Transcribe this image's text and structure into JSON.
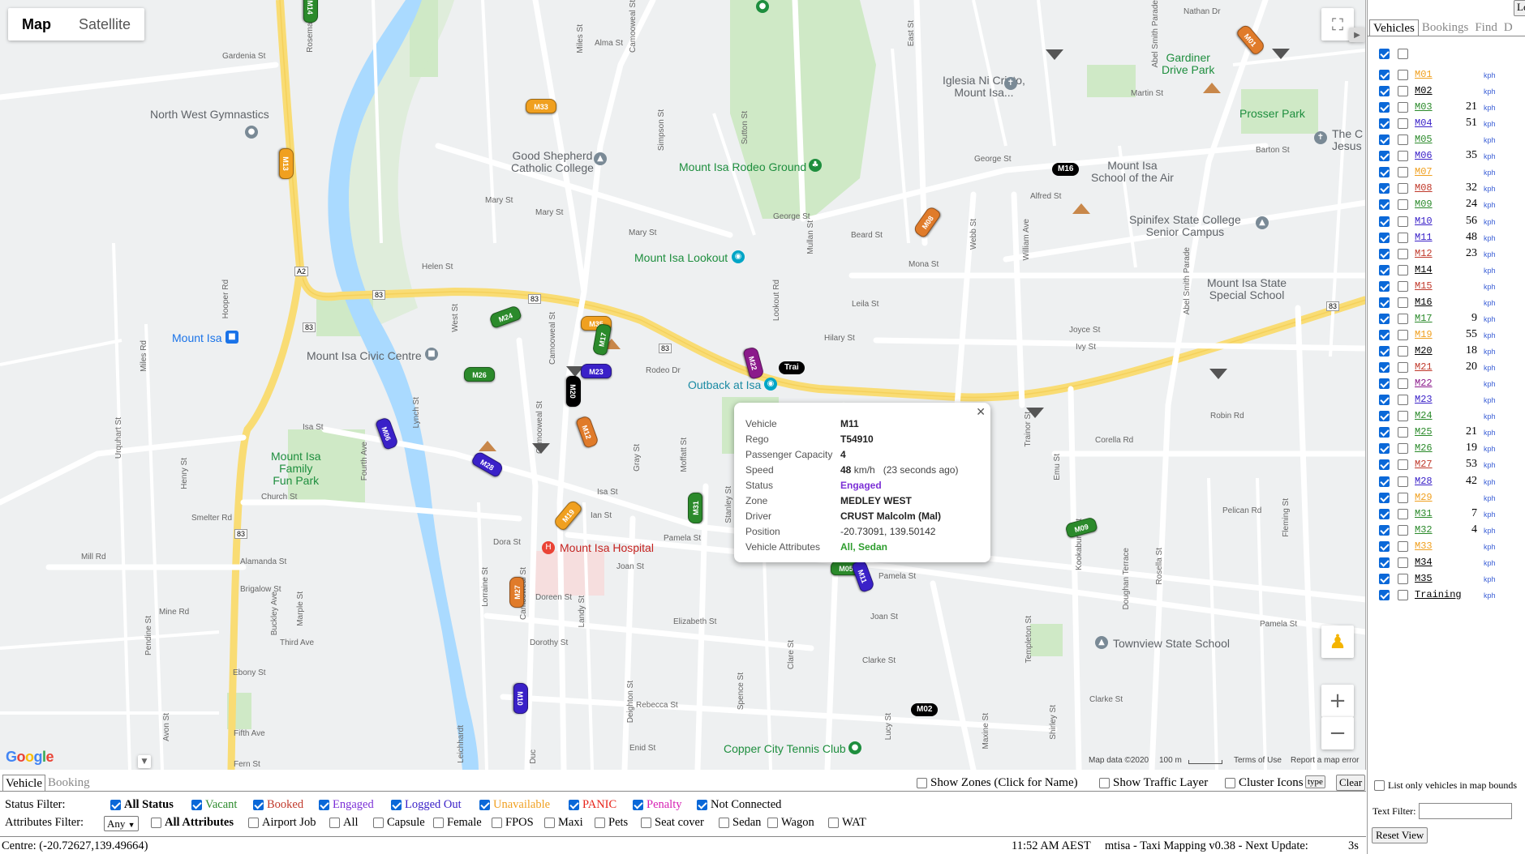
{
  "map": {
    "maptype": {
      "map_label": "Map",
      "satellite_label": "Satellite"
    },
    "attribution": {
      "map_data": "Map data ©2020",
      "scale": "100 m",
      "terms": "Terms of Use",
      "report": "Report a map error"
    },
    "google_logo": "Google",
    "places": {
      "north_west_gym": "North West Gymnastics",
      "good_shepherd": "Good Shepherd\nCatholic College",
      "rodeo": "Mount Isa Rodeo Ground",
      "iglesia": "Iglesia Ni Cristo,\nMount Isa...",
      "gardiner": "Gardiner\nDrive Park",
      "prosser": "Prosser Park",
      "the_c_jesus": "The C\nJesus",
      "school_air": "Mount Isa\nSchool of the Air",
      "spinifex": "Spinifex State College\nSenior Campus",
      "lookout": "Mount Isa Lookout",
      "special_school": "Mount Isa State\nSpecial School",
      "mount_isa": "Mount Isa",
      "civic_centre": "Mount Isa Civic Centre",
      "outback": "Outback at Isa",
      "family_park": "Mount Isa\nFamily\nFun Park",
      "hospital": "Mount Isa Hospital",
      "townview": "Townview State School",
      "tennis": "Copper City Tennis Club"
    },
    "streets": {
      "gardenia": "Gardenia St",
      "alma": "Alma St",
      "mary1": "Mary St",
      "mary2": "Mary St",
      "mary3": "Mary St",
      "helen": "Helen St",
      "george1": "George St",
      "george2": "George St",
      "beard": "Beard St",
      "mona": "Mona St",
      "leila": "Leila St",
      "hilary": "Hilary St",
      "joyce": "Joyce St",
      "ivy": "Ivy St",
      "corella": "Corella Rd",
      "robin": "Robin Rd",
      "pelican": "Pelican Rd",
      "pamela1": "Pamela St",
      "pamela2": "Pamela St",
      "pamela3": "Pamela St",
      "joan1": "Joan St",
      "joan2": "Joan St",
      "elizabeth": "Elizabeth St",
      "dorothy": "Dorothy St",
      "clarke1": "Clarke St",
      "clarke2": "Clarke St",
      "rebecca": "Rebecca St",
      "enid": "Enid St",
      "fern": "Fern St",
      "fifth": "Fifth Ave",
      "third": "Third Ave",
      "ebony": "Ebony St",
      "brigalow": "Brigalow St",
      "alamanda": "Alamanda St",
      "mill": "Mill Rd",
      "church": "Church St",
      "isa1": "Isa St",
      "isa2": "Isa St",
      "ian": "Ian St",
      "dora": "Dora St",
      "doreen": "Doreen St",
      "smelter": "Smelter Rd",
      "barton": "Barton St",
      "alfred": "Alfred St",
      "martin": "Martin St",
      "nathan": "Nathan Dr",
      "mine": "Mine Rd",
      "rodeo_dr": "Rodeo Dr",
      "camooweal1": "Camooweal St",
      "camooweal2": "Camooweal St",
      "camooweal3": "Camooweal St",
      "camooweal4": "Camooweal St",
      "abel1": "Abel Smith Parade",
      "abel2": "Abel Smith Parade",
      "leichhardt": "Leichhardt",
      "hooper": "Hooper Rd",
      "miles": "Miles Rd",
      "fourth": "Fourth Ave",
      "lynch": "Lynch St",
      "west": "West St",
      "simpson": "Simpson St",
      "sutton": "Sutton St",
      "mullan": "Mullan St",
      "east": "East St",
      "webb": "Webb St",
      "william": "William Ave",
      "lookout_rd": "Lookout Rd",
      "moffatt": "Moffatt St",
      "gray": "Gray St",
      "stanley": "Stanley St",
      "spence": "Spence St",
      "delungra": "Deighton St",
      "trainor": "Trainor St",
      "emu": "Emu St",
      "kookaburra": "Kookaburra St",
      "doughan": "Doughan Terrace",
      "rosella": "Rosella St",
      "templeton": "Templeton St",
      "shirley": "Shirley St",
      "lucy": "Lucy St",
      "maxine": "Maxine St",
      "fleming": "Fleming St",
      "buckley": "Buckley Ave",
      "marple": "Marple St",
      "urquhart": "Urquhart St",
      "henry": "Henry St",
      "pendine": "Pendine St",
      "avon": "Avon St",
      "rosemary": "Rosemary Ave",
      "miles_st": "Miles St",
      "lorraine": "Lorraine St",
      "landy": "Landy St",
      "clare": "Clare St",
      "dc": "Duc",
      "a2": "A2",
      "r83a": "83",
      "r83b": "83",
      "r83c": "83",
      "r83d": "83",
      "r83e": "83",
      "r83f": "83"
    },
    "vehicles": [
      {
        "id": "M01",
        "color": "#e07b2a"
      },
      {
        "id": "M33",
        "color": "#f0a020"
      },
      {
        "id": "M13",
        "color": "#f0a020"
      },
      {
        "id": "M16",
        "color": "#000000"
      },
      {
        "id": "M08",
        "color": "#e07b2a"
      },
      {
        "id": "M24",
        "color": "#2b8a2b"
      },
      {
        "id": "M35",
        "color": "#f0a020"
      },
      {
        "id": "M17",
        "color": "#2b8a2b"
      },
      {
        "id": "M26",
        "color": "#2b8a2b"
      },
      {
        "id": "M23",
        "color": "#3a21c8"
      },
      {
        "id": "M20",
        "color": "#000000"
      },
      {
        "id": "M22",
        "color": "#8b1a8b"
      },
      {
        "id": "Trai",
        "color": "#000000"
      },
      {
        "id": "M06",
        "color": "#3a21c8"
      },
      {
        "id": "M28",
        "color": "#3a21c8"
      },
      {
        "id": "M12",
        "color": "#e07b2a"
      },
      {
        "id": "M31",
        "color": "#2b8a2b"
      },
      {
        "id": "M09",
        "color": "#2b8a2b"
      },
      {
        "id": "M27",
        "color": "#e07b2a"
      },
      {
        "id": "M05",
        "color": "#2b8a2b"
      },
      {
        "id": "M11",
        "color": "#3a21c8"
      },
      {
        "id": "M10",
        "color": "#3a21c8"
      },
      {
        "id": "M02",
        "color": "#000000"
      },
      {
        "id": "M19",
        "color": "#f0a020"
      },
      {
        "id": "M14",
        "color": "#2b8a2b"
      }
    ],
    "popup": {
      "rows": [
        {
          "label": "Vehicle",
          "value": "M11"
        },
        {
          "label": "Rego",
          "value": "T54910"
        },
        {
          "label": "Passenger Capacity",
          "value": "4"
        },
        {
          "label": "Speed",
          "value": "48",
          "unit": "km/h",
          "ago": "(23 seconds ago)"
        },
        {
          "label": "Status",
          "value": "Engaged",
          "color": "#7b2fd6"
        },
        {
          "label": "Zone",
          "value": "MEDLEY WEST"
        },
        {
          "label": "Driver",
          "value": "CRUST Malcolm (Mal)"
        },
        {
          "label": "Position",
          "value": "-20.73091, 139.50142"
        },
        {
          "label": "Vehicle Attributes",
          "value": "All, Sedan",
          "color": "#2e9d2e"
        }
      ]
    }
  },
  "right_panel": {
    "tabs": [
      "Vehicles",
      "Bookings",
      "Find",
      "D"
    ],
    "top_button": "Lo",
    "unit": "kph",
    "vehicles": [
      {
        "code": "M01",
        "color": "#f0a020",
        "speed": ""
      },
      {
        "code": "M02",
        "color": "#000000",
        "speed": ""
      },
      {
        "code": "M03",
        "color": "#2b8a2b",
        "speed": "21"
      },
      {
        "code": "M04",
        "color": "#3a21c8",
        "speed": "51"
      },
      {
        "code": "M05",
        "color": "#2b8a2b",
        "speed": ""
      },
      {
        "code": "M06",
        "color": "#3a21c8",
        "speed": "35"
      },
      {
        "code": "M07",
        "color": "#f0a020",
        "speed": ""
      },
      {
        "code": "M08",
        "color": "#c0392b",
        "speed": "32"
      },
      {
        "code": "M09",
        "color": "#2b8a2b",
        "speed": "24"
      },
      {
        "code": "M10",
        "color": "#3a21c8",
        "speed": "56"
      },
      {
        "code": "M11",
        "color": "#3a21c8",
        "speed": "48"
      },
      {
        "code": "M12",
        "color": "#c0392b",
        "speed": "23"
      },
      {
        "code": "M14",
        "color": "#000000",
        "speed": ""
      },
      {
        "code": "M15",
        "color": "#c0392b",
        "speed": ""
      },
      {
        "code": "M16",
        "color": "#000000",
        "speed": ""
      },
      {
        "code": "M17",
        "color": "#2b8a2b",
        "speed": "9"
      },
      {
        "code": "M19",
        "color": "#f0a020",
        "speed": "55"
      },
      {
        "code": "M20",
        "color": "#000000",
        "speed": "18"
      },
      {
        "code": "M21",
        "color": "#c0392b",
        "speed": "20"
      },
      {
        "code": "M22",
        "color": "#8b1a8b",
        "speed": ""
      },
      {
        "code": "M23",
        "color": "#3a21c8",
        "speed": ""
      },
      {
        "code": "M24",
        "color": "#2b8a2b",
        "speed": ""
      },
      {
        "code": "M25",
        "color": "#2b8a2b",
        "speed": "21"
      },
      {
        "code": "M26",
        "color": "#2b8a2b",
        "speed": "19"
      },
      {
        "code": "M27",
        "color": "#c0392b",
        "speed": "53"
      },
      {
        "code": "M28",
        "color": "#3a21c8",
        "speed": "42"
      },
      {
        "code": "M29",
        "color": "#f0a020",
        "speed": ""
      },
      {
        "code": "M31",
        "color": "#2b8a2b",
        "speed": "7"
      },
      {
        "code": "M32",
        "color": "#2b8a2b",
        "speed": "4"
      },
      {
        "code": "M33",
        "color": "#f0a020",
        "speed": ""
      },
      {
        "code": "M34",
        "color": "#000000",
        "speed": ""
      },
      {
        "code": "M35",
        "color": "#000000",
        "speed": ""
      },
      {
        "code": "Training",
        "color": "#000000",
        "speed": ""
      }
    ],
    "list_only_label": "List only vehicles in map bounds",
    "text_filter_label": "Text Filter:",
    "text_filter_value": "",
    "reset_label": "Reset View"
  },
  "bottom": {
    "tabs": [
      "Vehicle",
      "Booking"
    ],
    "show_zones": "Show Zones (Click for Name)",
    "show_traffic": "Show Traffic Layer",
    "cluster_icons": "Cluster Icons",
    "type_button": "type",
    "clear_button": "Clear",
    "status_filter_label": "Status Filter:",
    "status_filters": [
      {
        "label": "All Status",
        "color": "#000000",
        "bold": true
      },
      {
        "label": "Vacant",
        "color": "#2b8a2b"
      },
      {
        "label": "Booked",
        "color": "#c0392b"
      },
      {
        "label": "Engaged",
        "color": "#7b2fd6"
      },
      {
        "label": "Logged Out",
        "color": "#3a21c8"
      },
      {
        "label": "Unavailable",
        "color": "#f0a020"
      },
      {
        "label": "PANIC",
        "color": "#e8241a"
      },
      {
        "label": "Penalty",
        "color": "#d61fb3"
      },
      {
        "label": "Not Connected",
        "color": "#000000"
      }
    ],
    "attributes_filter_label": "Attributes Filter:",
    "attributes_select": "Any",
    "attribute_filters": [
      "All Attributes",
      "Airport Job",
      "All",
      "Capsule",
      "Female",
      "FPOS",
      "Maxi",
      "Pets",
      "Seat cover",
      "Sedan",
      "Wagon",
      "WAT"
    ],
    "centre": "Centre: (-20.72627,139.49664)",
    "time": "11:52 AM AEST",
    "app_info": "mtisa - Taxi Mapping v0.38 - Next Update:",
    "countdown": "3s"
  }
}
